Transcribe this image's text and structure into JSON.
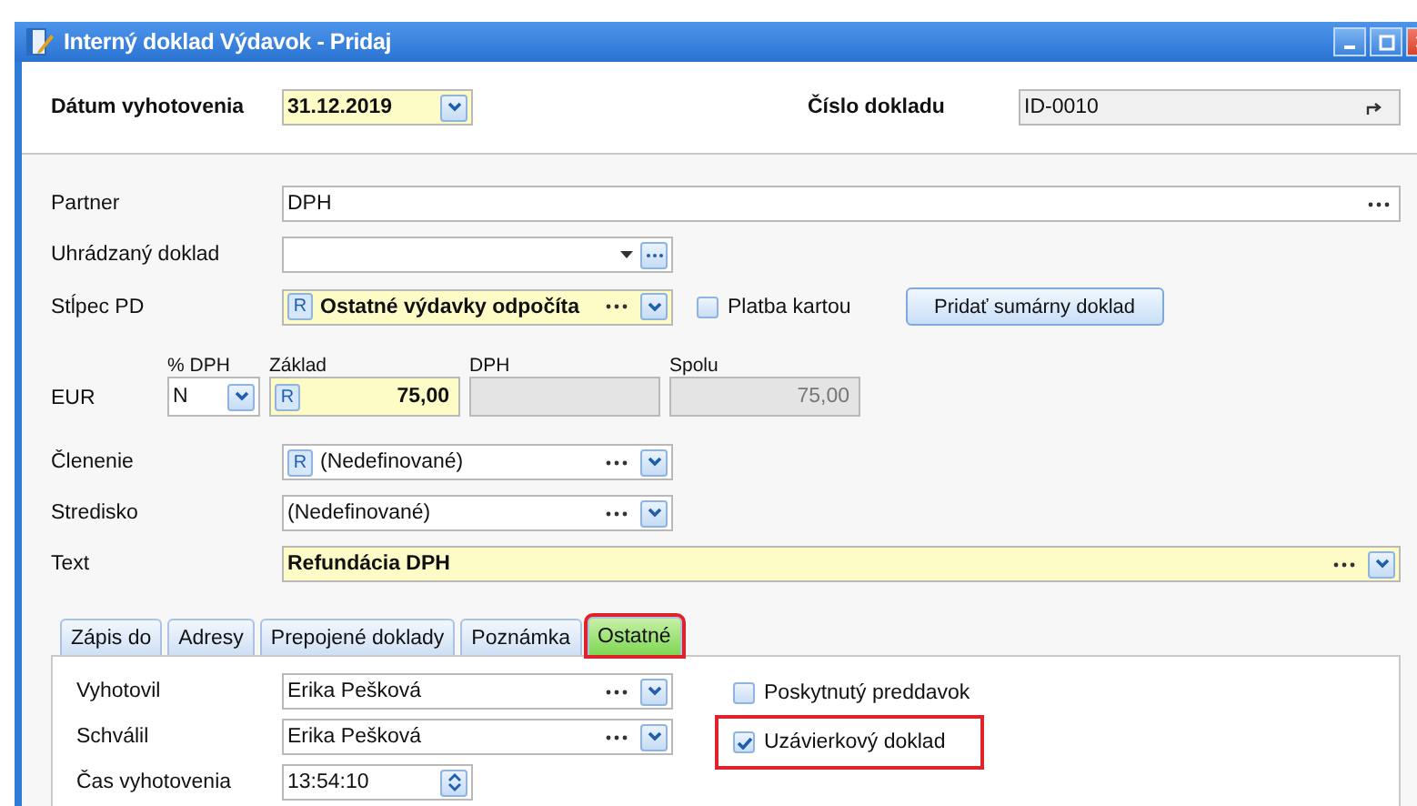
{
  "window": {
    "title": "Interný doklad Výdavok - Pridaj"
  },
  "header": {
    "date": {
      "label": "Dátum vyhotovenia",
      "value": "31.12.2019"
    },
    "number": {
      "label": "Číslo dokladu",
      "value": "ID-0010"
    }
  },
  "partner": {
    "label": "Partner",
    "value": "DPH"
  },
  "paid_document": {
    "label": "Uhrádzaný doklad"
  },
  "column_pd": {
    "label": "Stĺpec PD",
    "badge": "R",
    "value": "Ostatné výdavky odpočíta"
  },
  "card_payment": {
    "label": "Platba kartou",
    "checked": false
  },
  "add_button": "Pridať sumárny doklad",
  "amounts": {
    "currency": "EUR",
    "vat_rate": {
      "label": "% DPH",
      "value": "N"
    },
    "base": {
      "label": "Základ",
      "badge": "R",
      "value": "75,00"
    },
    "vat": {
      "label": "DPH"
    },
    "total": {
      "label": "Spolu",
      "value": "75,00"
    }
  },
  "division": {
    "label": "Členenie",
    "badge": "R",
    "value": "(Nedefinované)"
  },
  "center": {
    "label": "Stredisko",
    "value": "(Nedefinované)"
  },
  "text": {
    "label": "Text",
    "value": "Refundácia DPH"
  },
  "tabs": [
    {
      "label": "Zápis do",
      "selected": false,
      "highlighted": false
    },
    {
      "label": "Adresy",
      "selected": false,
      "highlighted": false
    },
    {
      "label": "Prepojené doklady",
      "selected": false,
      "highlighted": false
    },
    {
      "label": "Poznámka",
      "selected": false,
      "highlighted": false
    },
    {
      "label": "Ostatné",
      "selected": true,
      "highlighted": true
    }
  ],
  "tab_panel": {
    "people": [
      {
        "label": "Vyhotovil",
        "value": "Erika Pešková"
      },
      {
        "label": "Schválil",
        "value": "Erika Pešková"
      }
    ],
    "checkboxes": [
      {
        "label": "Poskytnutý preddavok",
        "checked": false,
        "highlighted": false
      },
      {
        "label": "Uzávierkový doklad",
        "checked": true,
        "highlighted": true
      }
    ],
    "time": {
      "label": "Čas vyhotovenia",
      "value": "13:54:10"
    }
  }
}
